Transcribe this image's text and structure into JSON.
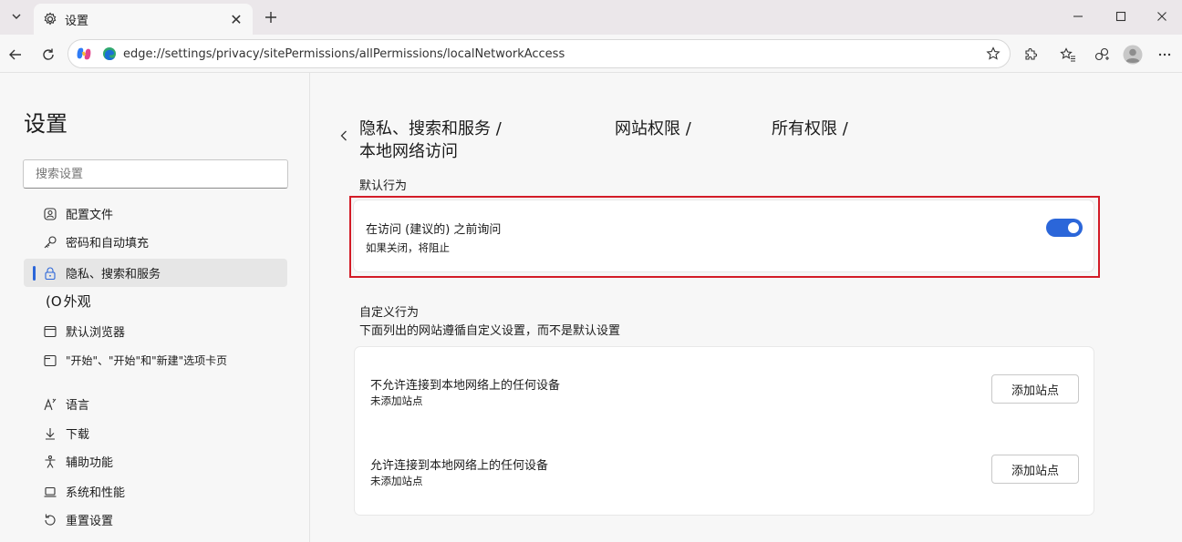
{
  "browser": {
    "tab_title": "设置",
    "tab_close_glyph": "✕",
    "url": "edge://settings/privacy/sitePermissions/allPermissions/localNetworkAccess"
  },
  "sidebar": {
    "title": "设置",
    "search_placeholder": "搜索设置",
    "items": [
      {
        "label": "配置文件",
        "icon": "profile-icon"
      },
      {
        "label": "密码和自动填充",
        "icon": "key-icon"
      },
      {
        "label": "隐私、搜索和服务",
        "icon": "lock-icon",
        "active": true
      },
      {
        "label": "外观",
        "icon": "appearance-icon",
        "prefix": "(O"
      },
      {
        "label": "默认浏览器",
        "icon": "browser-icon"
      },
      {
        "label": "\"开始\"、\"开始\"和\"新建\"选项卡页",
        "icon": "newtab-icon"
      },
      {
        "label": "语言",
        "icon": "language-icon"
      },
      {
        "label": "下载",
        "icon": "download-icon"
      },
      {
        "label": "辅助功能",
        "icon": "accessibility-icon"
      },
      {
        "label": "系统和性能",
        "icon": "laptop-icon"
      },
      {
        "label": "重置设置",
        "icon": "reset-icon"
      }
    ]
  },
  "breadcrumb": {
    "part1": "隐私、搜索和服务 /",
    "part2": "网站权限 /",
    "part3": "所有权限 /",
    "current": "本地网络访问"
  },
  "default_behavior": {
    "heading": "默认行为",
    "title": "在访问 (建议的) 之前询问",
    "subtitle": "如果关闭，将阻止",
    "toggle_on": true,
    "accent": "#2b66d9"
  },
  "custom_behavior": {
    "heading": "自定义行为",
    "description": "下面列出的网站遵循自定义设置，而不是默认设置",
    "block": {
      "title": "不允许连接到本地网络上的任何设备",
      "subtitle": "未添加站点",
      "button": "添加站点"
    },
    "allow": {
      "title": "允许连接到本地网络上的任何设备",
      "subtitle": "未添加站点",
      "button": "添加站点"
    }
  }
}
